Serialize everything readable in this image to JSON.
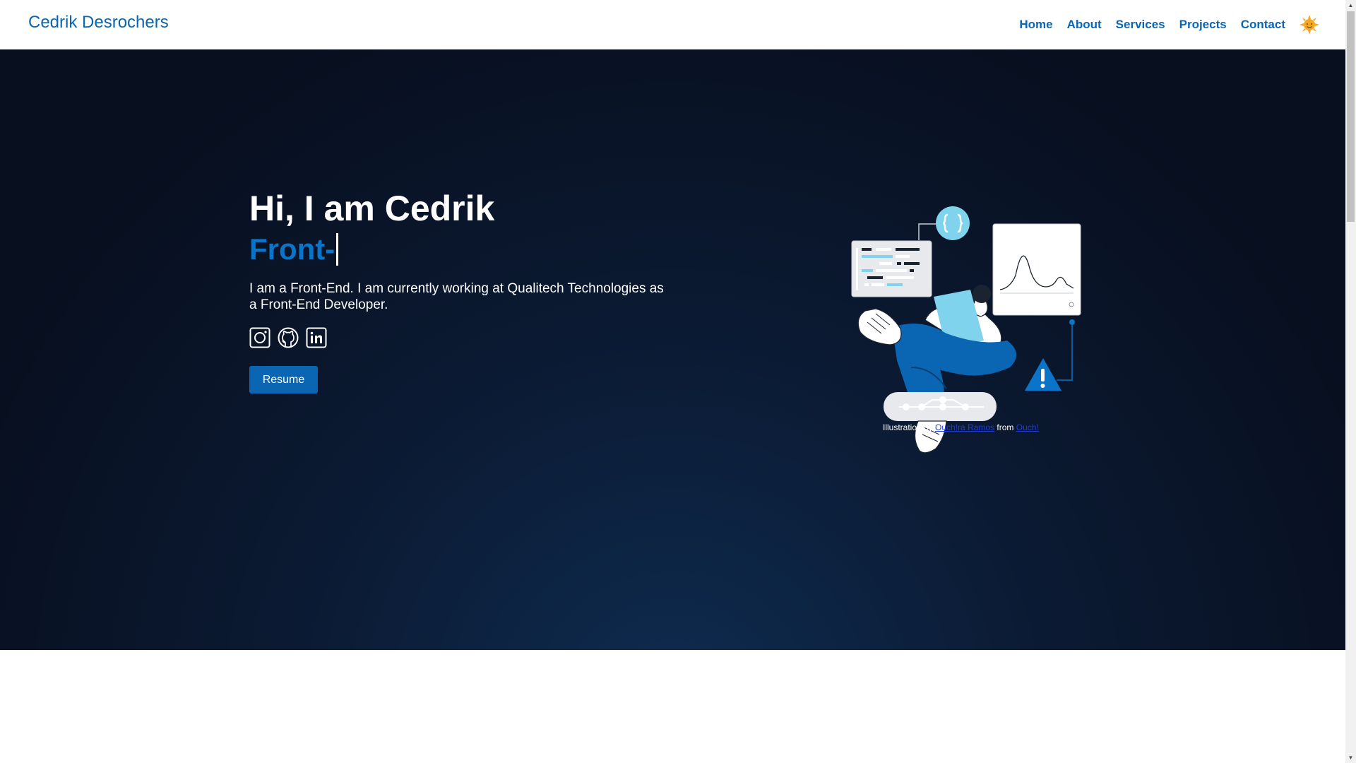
{
  "header": {
    "brand": "Cedrik Desrochers",
    "nav": [
      "Home",
      "About",
      "Services",
      "Projects",
      "Contact"
    ],
    "theme_icon": "sun-icon"
  },
  "hero": {
    "title": "Hi, I am Cedrik",
    "role": "Front-",
    "description": "I am a Front-End. I am currently working at Qualitech Technologies as a Front-End Developer.",
    "socials": [
      "instagram-icon",
      "github-icon",
      "linkedin-icon"
    ],
    "resume_label": "Resume",
    "credit": {
      "prefix": "Illustration by",
      "author": "Ouch!ra Ramos",
      "middle": "from",
      "source": "Ouch!"
    }
  },
  "colors": {
    "accent": "#0a66b2",
    "hero_bg": "#0b1a33"
  }
}
